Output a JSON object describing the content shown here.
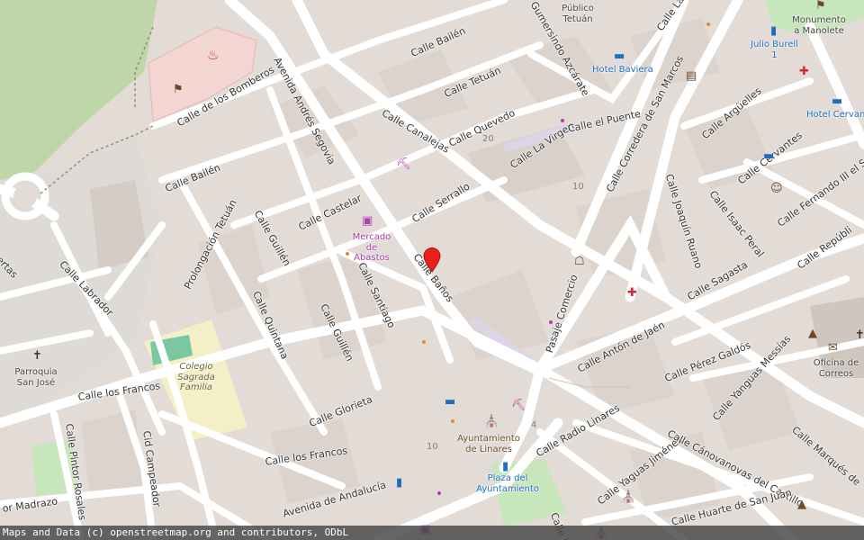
{
  "colors": {
    "background": "#e3dcd6",
    "road": "#ffffff",
    "park": "#c8e6bc",
    "school": "#f5efc8",
    "marker": "#e8211d"
  },
  "streets": {
    "bailen_top": "Calle Bailén",
    "bailen_left": "Calle Bailén",
    "bomberos": "Calle de los Bomberos",
    "andres_segovia": "Avenida Andrés Segovia",
    "tetuan": "Calle Tetuán",
    "quevedo": "Calle Quevedo",
    "canalejas": "Calle Canalejas",
    "azcarate": "Gumersindo Azcárate",
    "la_virgen": "Calle La Virgen",
    "el_puente": "Calle el Puente",
    "san_marcos": "Calle Corredera de San Marcos",
    "la_virgen_top": "Calle La V",
    "arguelles": "Calle Argüelles",
    "cervantes": "Calle Cervantes",
    "fernando": "Calle Fernando III el Sa",
    "joaquin_ruano": "Calle Joaquín Ruano",
    "isaac_peral": "Calle Isaac Peral",
    "republica": "Calle Repúbli",
    "serrallo": "Calle Serrallo",
    "castelar": "Calle Castelar",
    "guillen_upper": "Calle Guillén",
    "prolongacion_tetuan": "Prolongación Tetuán",
    "banos": "Calle Baños",
    "santiago": "Calle Santiago",
    "guillen_lower": "Calle Guillén",
    "quintana": "Calle Quintana",
    "labrador": "Calle Labrador",
    "huertas": "ertas",
    "sagasta": "Calle Sagasta",
    "pasaje_comercio": "Pasaje Comercio",
    "anton_jaen": "Calle Antón de Jaén",
    "perez_galdos": "Calle Pérez Galdós",
    "yanguas_messias": "Calle Yanguas Messías",
    "marques": "Calle Marqués de",
    "glorieta": "Calle Glorieta",
    "radio_linares": "Calle Radio Linares",
    "yaguas_jimenez": "Calle Yaguas Jiménez",
    "canovanovas": "Calle Cánovanovas del Castillo",
    "huarte": "Calle Huarte de San Juan",
    "los_francos_left": "Calle los Francos",
    "los_francos_mid": "Calle los Francos",
    "cid_campeador": "Cid Campeador",
    "pintor_rosales": "Calle Pintor Rosales",
    "madrazo": "or Madrazo",
    "andalucia": "Avenida de Andalucía",
    "calle_ig": "Calle Ig"
  },
  "pois": {
    "mercado": "Mercado de Abastos",
    "hotel_baviera": "Hotel Baviera",
    "julio_burell": "Julio Burell",
    "julio_burell_ref": "1",
    "hotel_cervantes": "Hotel Cervant",
    "monumento": "Monumento a Manolete",
    "parroquia": "Parroquia San José",
    "colegio": "Colegio Sagrada Familia",
    "ayuntamiento": "Ayuntamiento de Linares",
    "plaza_ayuntamiento": "Plaza del Ayuntamiento",
    "correos": "Oficina de Correos",
    "publico_tetuan": "Público Tetuán"
  },
  "house_numbers": {
    "n20": "20",
    "n10a": "10",
    "n10b": "10",
    "n4": "4"
  },
  "icons": {
    "fire_station": "fire-station-icon",
    "tower": "tower-icon",
    "market": "shopping-cart-icon",
    "hotel": "bed-icon",
    "bus": "bus-stop-icon",
    "book": "library-icon",
    "pharmacy": "pharmacy-icon",
    "theatre": "theatre-icon",
    "church": "cross-icon",
    "townhall": "townhall-icon",
    "post": "post-office-icon",
    "marker": "map-pin-icon",
    "fountain": "fountain-icon"
  },
  "attribution": "Maps and Data (c) openstreetmap.org and contributors, ODbL"
}
